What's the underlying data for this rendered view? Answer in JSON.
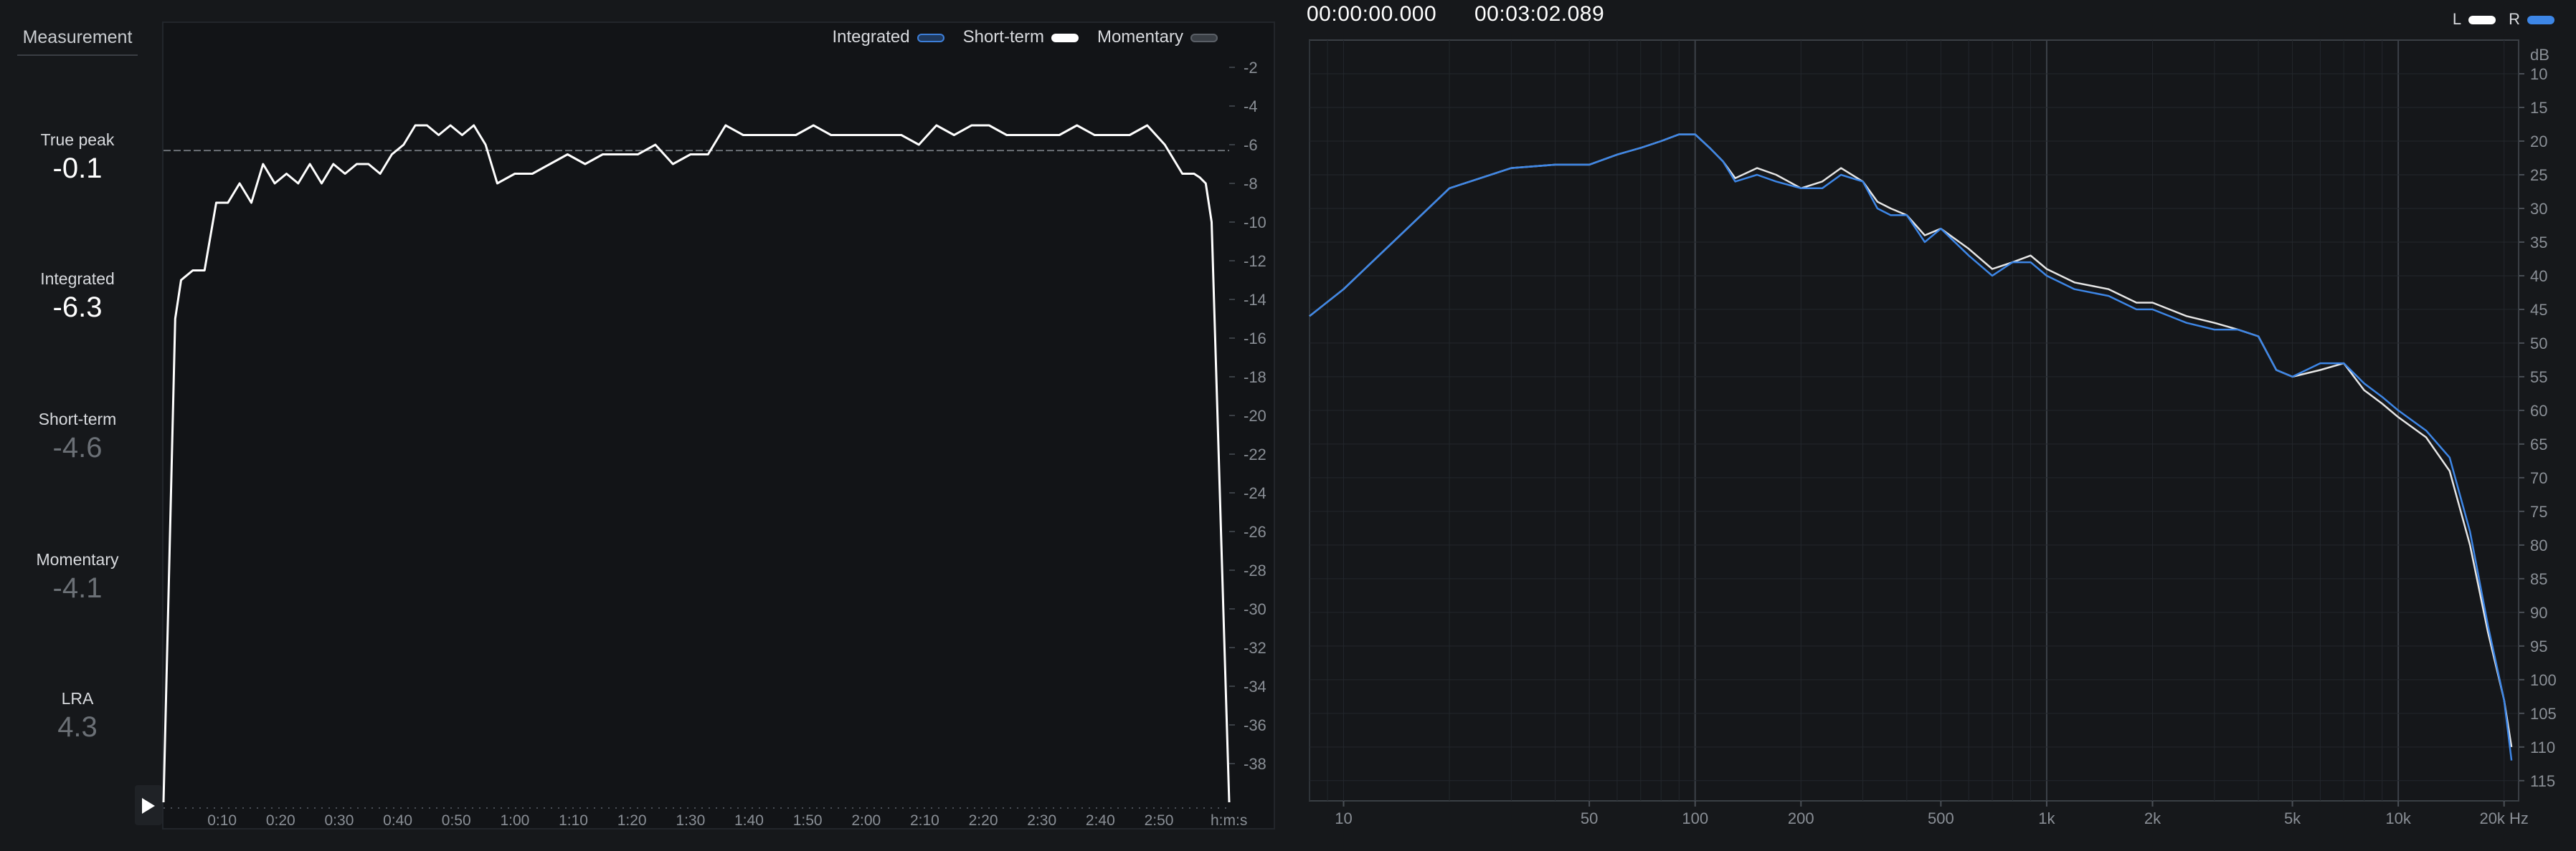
{
  "sidebar": {
    "header": "Measurement",
    "metrics": [
      {
        "label": "True peak",
        "value": "-0.1"
      },
      {
        "label": "Integrated",
        "value": "-6.3"
      },
      {
        "label": "Short-term",
        "value": "-4.6"
      },
      {
        "label": "Momentary",
        "value": "-4.1"
      },
      {
        "label": "LRA",
        "value": "4.3"
      }
    ]
  },
  "loudness": {
    "legend": [
      "Integrated",
      "Short-term",
      "Momentary"
    ],
    "y_ticks": [
      "-2",
      "-4",
      "-6",
      "-8",
      "-10",
      "-12",
      "-14",
      "-16",
      "-18",
      "-20",
      "-22",
      "-24",
      "-26",
      "-28",
      "-30",
      "-32",
      "-34",
      "-36",
      "-38"
    ],
    "x_ticks": [
      "0:10",
      "0:20",
      "0:30",
      "0:40",
      "0:50",
      "1:00",
      "1:10",
      "1:20",
      "1:30",
      "1:40",
      "1:50",
      "2:00",
      "2:10",
      "2:20",
      "2:30",
      "2:40",
      "2:50"
    ],
    "x_unit": "h:m:s",
    "integrated_value": -6.3
  },
  "spectrum": {
    "time_start": "00:00:00.000",
    "time_end": "00:03:02.089",
    "channel_legend": [
      "L",
      "R"
    ],
    "y_unit": "dB",
    "y_ticks": [
      "10",
      "15",
      "20",
      "25",
      "30",
      "35",
      "40",
      "45",
      "50",
      "55",
      "60",
      "65",
      "70",
      "75",
      "80",
      "85",
      "90",
      "95",
      "100",
      "105",
      "110",
      "115"
    ],
    "x_ticks": [
      "10",
      "50",
      "100",
      "200",
      "500",
      "1k",
      "2k",
      "5k",
      "10k",
      "20k Hz"
    ]
  },
  "colors": {
    "short_term": "#ffffff",
    "integrated": "#3d7fd9",
    "momentary": "#8a8f96",
    "spectrum_L": "#e6e6e6",
    "spectrum_R": "#3d86e6"
  },
  "chart_data": [
    {
      "type": "line",
      "xlabel": "h:m:s",
      "ylim": [
        -40,
        0
      ],
      "xlim_seconds": [
        0,
        182
      ],
      "series": [
        {
          "name": "Short-term",
          "x": [
            0,
            2,
            3,
            5,
            7,
            9,
            11,
            13,
            15,
            17,
            19,
            21,
            23,
            25,
            27,
            29,
            31,
            33,
            35,
            37,
            39,
            41,
            43,
            45,
            47,
            49,
            51,
            53,
            55,
            57,
            60,
            63,
            66,
            69,
            72,
            75,
            78,
            81,
            84,
            87,
            90,
            93,
            96,
            99,
            102,
            105,
            108,
            111,
            114,
            117,
            120,
            123,
            126,
            129,
            132,
            135,
            138,
            141,
            144,
            147,
            150,
            153,
            156,
            159,
            162,
            165,
            168,
            171,
            174,
            176,
            177,
            178,
            179,
            180,
            181,
            182
          ],
          "y": [
            -40,
            -15,
            -13,
            -12.5,
            -12.5,
            -9,
            -9,
            -8,
            -9,
            -7,
            -8,
            -7.5,
            -8,
            -7,
            -8,
            -7,
            -7.5,
            -7,
            -7,
            -7.5,
            -6.5,
            -6,
            -5,
            -5,
            -5.5,
            -5,
            -5.5,
            -5,
            -6,
            -8,
            -7.5,
            -7.5,
            -7,
            -6.5,
            -7,
            -6.5,
            -6.5,
            -6.5,
            -6,
            -7,
            -6.5,
            -6.5,
            -5,
            -5.5,
            -5.5,
            -5.5,
            -5.5,
            -5,
            -5.5,
            -5.5,
            -5.5,
            -5.5,
            -5.5,
            -6,
            -5,
            -5.5,
            -5,
            -5,
            -5.5,
            -5.5,
            -5.5,
            -5.5,
            -5,
            -5.5,
            -5.5,
            -5.5,
            -5,
            -6,
            -7.5,
            -7.5,
            -7.7,
            -8,
            -10,
            -20,
            -30,
            -40
          ]
        },
        {
          "name": "Integrated",
          "x": [
            0,
            182
          ],
          "y": [
            -6.3,
            -6.3
          ]
        }
      ]
    },
    {
      "type": "line",
      "x_scale": "log",
      "xlabel": "Hz",
      "ylabel": "dB",
      "ylim": [
        5,
        118
      ],
      "series": [
        {
          "name": "L",
          "x": [
            8,
            10,
            20,
            30,
            40,
            50,
            60,
            70,
            80,
            90,
            100,
            110,
            120,
            130,
            150,
            170,
            200,
            230,
            260,
            300,
            330,
            360,
            400,
            450,
            500,
            600,
            700,
            800,
            900,
            1000,
            1200,
            1500,
            1800,
            2000,
            2500,
            3000,
            3500,
            4000,
            4500,
            5000,
            6000,
            7000,
            8000,
            9000,
            10000,
            12000,
            14000,
            16000,
            18000,
            20000,
            21000
          ],
          "y": [
            46,
            42,
            27,
            24,
            23.5,
            23.5,
            22,
            21,
            20,
            19,
            19,
            21,
            23,
            25.5,
            24,
            25,
            27,
            26,
            24,
            26,
            29,
            30,
            31,
            34,
            33,
            36,
            39,
            38,
            37,
            39,
            41,
            42,
            44,
            44,
            46,
            47,
            48,
            49,
            54,
            55,
            54,
            53,
            57,
            59,
            61,
            64,
            69,
            80,
            93,
            103,
            110
          ]
        },
        {
          "name": "R",
          "x": [
            8,
            10,
            20,
            30,
            40,
            50,
            60,
            70,
            80,
            90,
            100,
            110,
            120,
            130,
            150,
            170,
            200,
            230,
            260,
            300,
            330,
            360,
            400,
            450,
            500,
            600,
            700,
            800,
            900,
            1000,
            1200,
            1500,
            1800,
            2000,
            2500,
            3000,
            3500,
            4000,
            4500,
            5000,
            6000,
            7000,
            8000,
            9000,
            10000,
            12000,
            14000,
            16000,
            18000,
            20000,
            21000
          ],
          "y": [
            46,
            42,
            27,
            24,
            23.5,
            23.5,
            22,
            21,
            20,
            19,
            19,
            21,
            23,
            26,
            25,
            26,
            27,
            27,
            25,
            26,
            30,
            31,
            31,
            35,
            33,
            37,
            40,
            38,
            38,
            40,
            42,
            43,
            45,
            45,
            47,
            48,
            48,
            49,
            54,
            55,
            53,
            53,
            56,
            58,
            60,
            63,
            67,
            78,
            92,
            103,
            112
          ]
        }
      ]
    }
  ]
}
